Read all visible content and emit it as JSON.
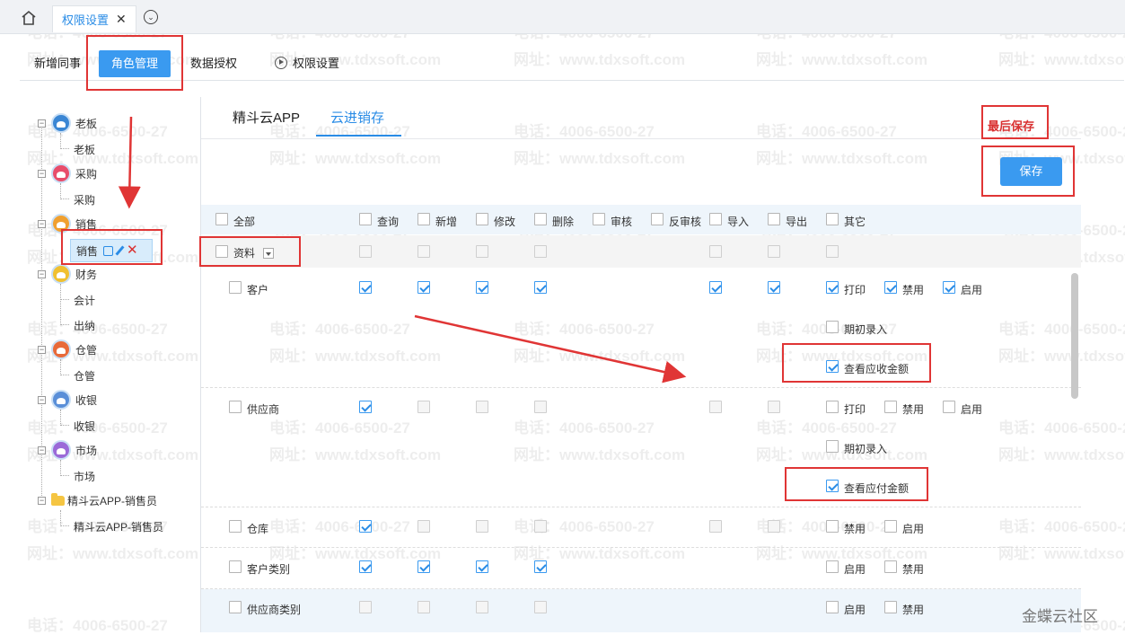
{
  "top_tab": {
    "label": "权限设置",
    "close": "✕"
  },
  "sub_tabs": [
    "新增同事",
    "角色管理",
    "数据授权",
    "权限设置"
  ],
  "tree": {
    "groups": [
      {
        "label": "老板",
        "child": "老板"
      },
      {
        "label": "采购",
        "child": "采购"
      },
      {
        "label": "销售",
        "child": "销售"
      },
      {
        "label": "财务",
        "children": [
          "会计",
          "出纳"
        ]
      },
      {
        "label": "仓管",
        "child": "仓管"
      },
      {
        "label": "收银",
        "child": "收银"
      },
      {
        "label": "市场",
        "child": "市场"
      },
      {
        "label": "精斗云APP-销售员",
        "child": "精斗云APP-销售员"
      }
    ]
  },
  "app_tabs": [
    "精斗云APP",
    "云进销存"
  ],
  "final_save": "最后保存",
  "save_button": "保存",
  "header_cols": [
    "全部",
    "查询",
    "新增",
    "修改",
    "删除",
    "审核",
    "反审核",
    "导入",
    "导出",
    "其它"
  ],
  "group_row": {
    "label": "资料"
  },
  "rows": {
    "customer": {
      "label": "客户",
      "opt1": "打印",
      "opt2": "禁用",
      "opt3": "启用",
      "extra1": "期初录入",
      "extra2": "查看应收金额"
    },
    "supplier": {
      "label": "供应商",
      "opt1": "打印",
      "opt2": "禁用",
      "opt3": "启用",
      "extra1": "期初录入",
      "extra2": "查看应付金额"
    },
    "warehouse": {
      "label": "仓库",
      "opt1": "禁用",
      "opt2": "启用"
    },
    "customer_type": {
      "label": "客户类别",
      "opt1": "启用",
      "opt2": "禁用"
    },
    "supplier_type": {
      "label": "供应商类别",
      "opt1": "启用",
      "opt2": "禁用"
    }
  },
  "watermark": {
    "phone": "电话：4006-6500-27",
    "site": "网址：www.tdxsoft.com"
  },
  "footer_mark": "金蝶云社区",
  "colors": {
    "accent": "#3a9af0",
    "annotation": "#e03535"
  }
}
